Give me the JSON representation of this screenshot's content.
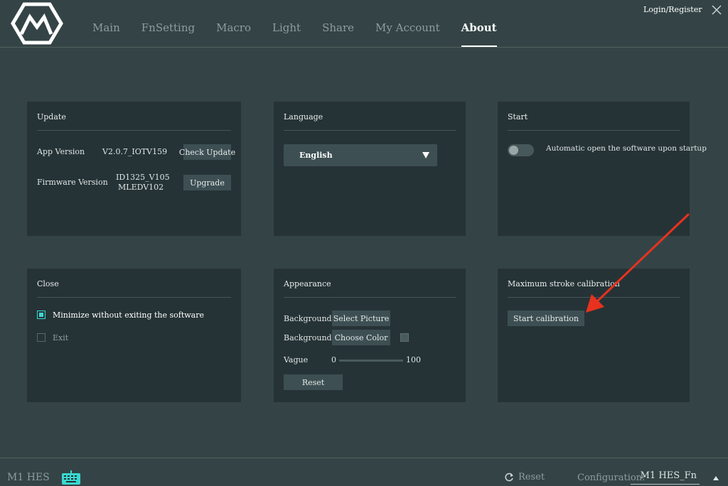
{
  "header": {
    "nav": [
      "Main",
      "FnSetting",
      "Macro",
      "Light",
      "Share",
      "My Account",
      "About"
    ],
    "active_tab": "About",
    "login_label": "Login/Register",
    "close_icon": "close-icon",
    "logo_icon": "brand-logo-icon"
  },
  "update": {
    "title": "Update",
    "app_version_label": "App Version",
    "app_version_value": "V2.0.7_IOTV159",
    "check_update_label": "Check Update",
    "firmware_label": "Firmware Version",
    "firmware_value_line1": "ID1325_V105",
    "firmware_value_line2": "MLEDV102",
    "upgrade_label": "Upgrade"
  },
  "language": {
    "title": "Language",
    "selected": "English",
    "arrow_icon": "triangle-down-icon"
  },
  "start": {
    "title": "Start",
    "auto_open_label": "Automatic open the software upon startup",
    "auto_open_enabled": false
  },
  "close": {
    "title": "Close",
    "minimize_label": "Minimize without exiting the software",
    "minimize_checked": true,
    "exit_label": "Exit",
    "exit_checked": false
  },
  "appearance": {
    "title": "Appearance",
    "bg_label_1": "Background",
    "select_picture_label": "Select Picture",
    "bg_label_2": "Background",
    "choose_color_label": "Choose Color",
    "vague_label": "Vague",
    "vague_min": "0",
    "vague_max": "100",
    "reset_label": "Reset"
  },
  "calibration": {
    "title": "Maximum stroke calibration",
    "start_label": "Start calibration",
    "annotation_color": "#e8321e"
  },
  "footer": {
    "device_name": "M1 HES",
    "keyboard_icon": "keyboard-icon",
    "reset_label": "Reset",
    "config_label": "Configuration:",
    "config_value": "M1 HES_Fn"
  },
  "colors": {
    "background": "#344446",
    "card": "#263336",
    "button": "#3d4f52",
    "accent": "#38d8d0"
  }
}
